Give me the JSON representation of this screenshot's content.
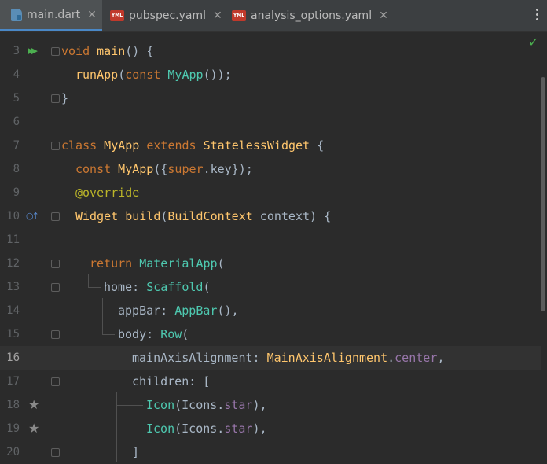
{
  "tabs": [
    {
      "label": "main.dart",
      "icon": "dart-file-icon",
      "active": true
    },
    {
      "label": "pubspec.yaml",
      "icon": "yaml-file-icon",
      "active": false
    },
    {
      "label": "analysis_options.yaml",
      "icon": "yaml-file-icon",
      "active": false
    }
  ],
  "yml_badge": "YML",
  "close_glyph": "✕",
  "line_numbers": [
    "3",
    "4",
    "5",
    "6",
    "7",
    "8",
    "9",
    "10",
    "11",
    "12",
    "13",
    "14",
    "15",
    "16",
    "17",
    "18",
    "19",
    "20"
  ],
  "current_line": "16",
  "status": {
    "icon": "check-icon",
    "glyph": "✓",
    "color": "#4caf50"
  },
  "gutter_icons": {
    "run": "▶▶",
    "override": "○↑",
    "star": "★"
  },
  "code": {
    "l3": [
      "void",
      "main",
      "() {"
    ],
    "l4": [
      "runApp",
      "(",
      "const",
      " MyApp",
      "());"
    ],
    "l5": [
      "}"
    ],
    "l7": [
      "class",
      " MyApp ",
      "extends",
      " StatelessWidget",
      " {"
    ],
    "l8": [
      "const",
      " MyApp",
      "({",
      "super",
      ".key});"
    ],
    "l9": [
      "@override"
    ],
    "l10": [
      "Widget",
      " build",
      "(",
      "BuildContext",
      " context) {"
    ],
    "l12": [
      "return",
      " MaterialApp",
      "("
    ],
    "l13": [
      "home: ",
      "Scaffold",
      "("
    ],
    "l14": [
      "appBar: ",
      "AppBar",
      "(),"
    ],
    "l15": [
      "body: ",
      "Row",
      "("
    ],
    "l16": [
      "mainAxisAlignment: ",
      "MainAxisAlignment",
      ".",
      "center",
      ","
    ],
    "l17": [
      "children: ["
    ],
    "l18": [
      "Icon",
      "(Icons.",
      "star",
      "),"
    ],
    "l19": [
      "Icon",
      "(Icons.",
      "star",
      "),"
    ],
    "l20": [
      "]"
    ]
  },
  "colors": {
    "keyword": "#cc7832",
    "function": "#ffc66d",
    "widget": "#4ec9b0",
    "field": "#9876aa",
    "annotation": "#bbb529",
    "text": "#a9b7c6",
    "background": "#2b2b2b",
    "tab_accent": "#4a88c7"
  }
}
